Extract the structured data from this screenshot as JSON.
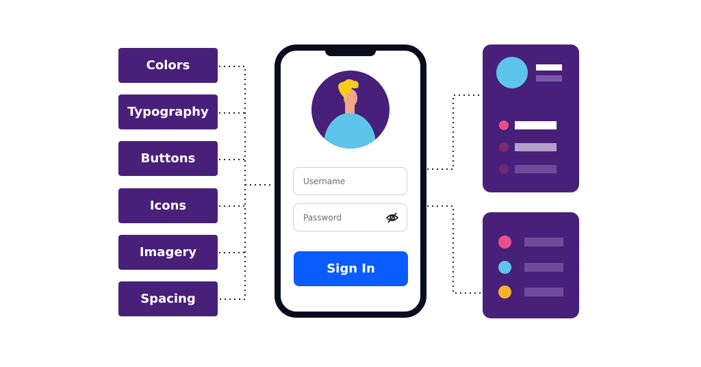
{
  "categories": [
    {
      "label": "Colors"
    },
    {
      "label": "Typography"
    },
    {
      "label": "Buttons"
    },
    {
      "label": "Icons"
    },
    {
      "label": "Imagery"
    },
    {
      "label": "Spacing"
    }
  ],
  "phone": {
    "username_placeholder": "Username",
    "password_placeholder": "Password",
    "password_icon": "eye-slash-icon",
    "signin_label": "Sign In"
  },
  "colors": {
    "brand_purple": "#48207a",
    "button_blue": "#0b5cff",
    "pink": "#e8508c",
    "cyan": "#5ec5ea",
    "orange": "#f7b22a"
  }
}
